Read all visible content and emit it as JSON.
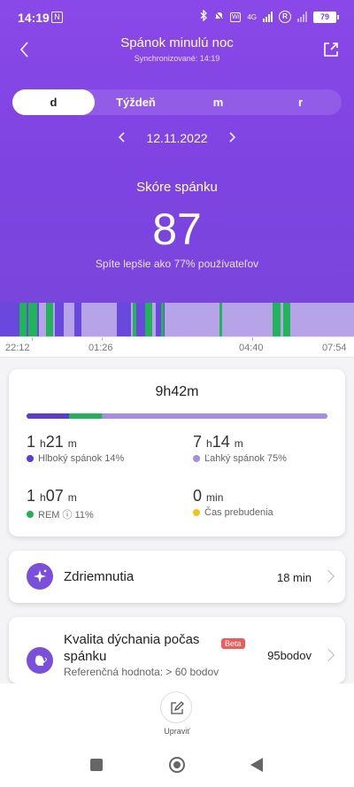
{
  "status_bar": {
    "time": "14:19",
    "nfc_glyph": "N",
    "network_label": "4G",
    "battery": "79"
  },
  "header": {
    "title": "Spánok minulú noc",
    "subtitle": "Synchronizované: 14:19"
  },
  "tabs": [
    {
      "label": "d",
      "active": true
    },
    {
      "label": "Týždeň",
      "active": false
    },
    {
      "label": "m",
      "active": false
    },
    {
      "label": "r",
      "active": false
    }
  ],
  "date": "12.11.2022",
  "score": {
    "label": "Skóre spánku",
    "value": "87",
    "comparison": "Spíte lepšie ako 77% používateľov"
  },
  "timeline": {
    "ticks": [
      "22:12",
      "01:26",
      "04:40",
      "07:54"
    ],
    "colors": {
      "deep": "#6a47dd",
      "light": "#b7a3e8",
      "rem": "#22b45a"
    }
  },
  "summary": {
    "total": "9h42m",
    "stage_fractions": {
      "deep": 0.14,
      "rem": 0.11,
      "light": 0.75
    },
    "stats": [
      {
        "hours": "1",
        "h_unit": "h",
        "minutes": "21",
        "m_unit": "m",
        "label": "Hlboký spánok 14%",
        "color": "#5a3bd6"
      },
      {
        "hours": "7",
        "h_unit": "h",
        "minutes": "14",
        "m_unit": "m",
        "label": "Ľahký spánok 75%",
        "color": "#a58ce6"
      },
      {
        "hours": "1",
        "h_unit": "h",
        "minutes": "07",
        "m_unit": "m",
        "label": "REM ⓘ 11%",
        "color": "#1fb356"
      },
      {
        "hours": "0",
        "h_unit": "",
        "minutes": "",
        "m_unit": "min",
        "label": "Čas prebudenia",
        "color": "#f2c418"
      }
    ]
  },
  "naps": {
    "title": "Zdriemnutia",
    "value": "18 min"
  },
  "breathing": {
    "title_line1": "Kvalita dýchania počas",
    "title_line2": "spánku",
    "badge": "Beta",
    "value": "95bodov",
    "reference": "Referenčná hodnota: > 60 bodov"
  },
  "bottom": {
    "edit_label": "Upraviť"
  }
}
